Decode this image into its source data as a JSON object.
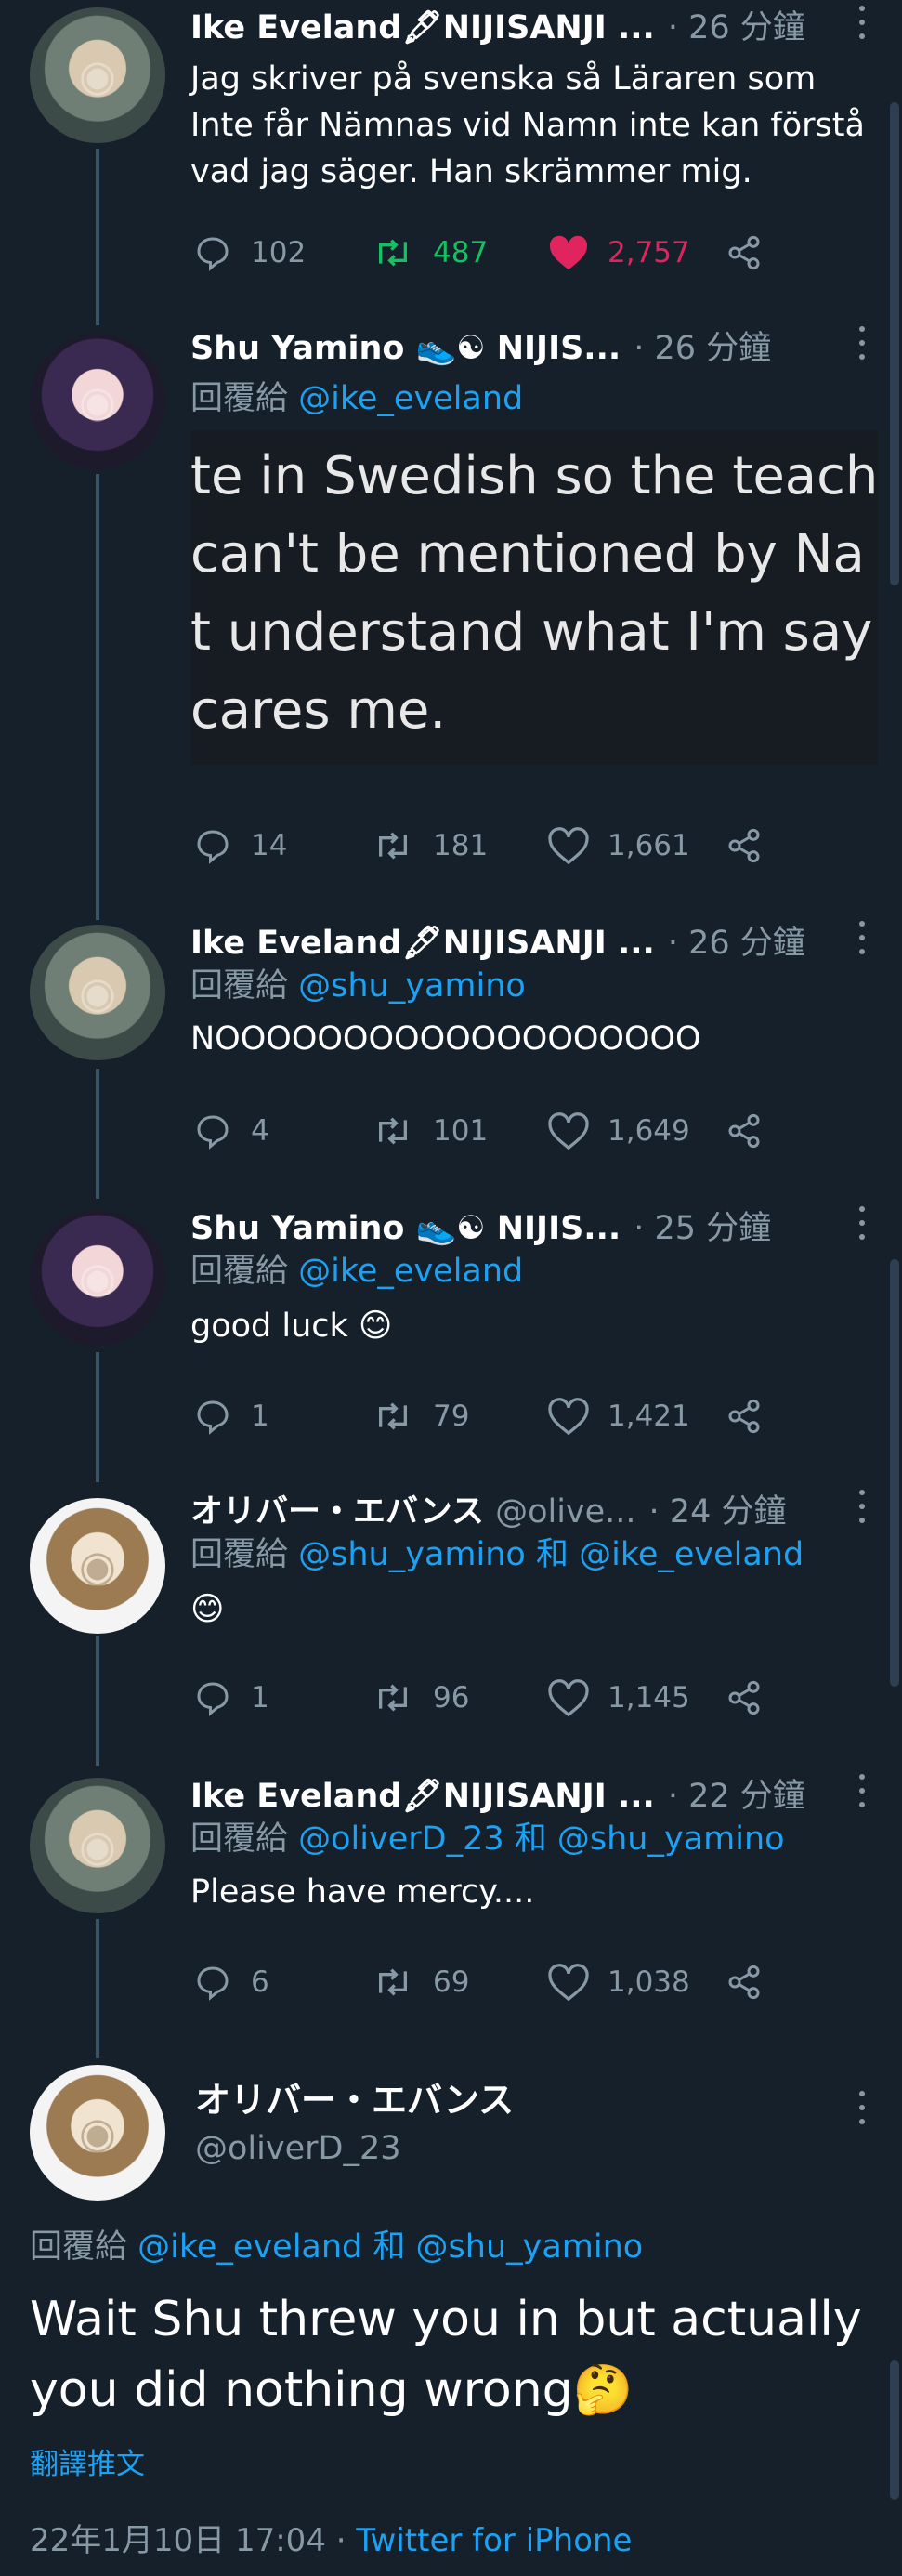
{
  "colors": {
    "background": "#15202b",
    "muted": "#8899a6",
    "link": "#1da1f2",
    "retweet_active": "#17bf63",
    "like_active": "#e0245e"
  },
  "tweets": [
    {
      "author": "Ike Eveland🖋NIJISANJI ...",
      "time": "· 26 分鐘",
      "text": "Jag skriver på svenska så Läraren som Inte får Nämnas vid Namn inte kan förstå vad jag säger. Han skrämmer mig.",
      "replies": "102",
      "retweets": "487",
      "likes": "2,757"
    },
    {
      "author": "Shu Yamino 👟☯ NIJIS...",
      "time": "· 26 分鐘",
      "reply_prefix": "回覆給 ",
      "reply_to": "@ike_eveland",
      "image_lines": [
        "te in Swedish so the teach",
        " can't be mentioned by Na",
        "t understand what I'm say",
        "cares me."
      ],
      "replies": "14",
      "retweets": "181",
      "likes": "1,661"
    },
    {
      "author": "Ike Eveland🖋NIJISANJI ...",
      "time": "· 26 分鐘",
      "reply_prefix": "回覆給 ",
      "reply_to": "@shu_yamino",
      "text": "NOOOOOOOOOOOOOOOOOOO",
      "replies": "4",
      "retweets": "101",
      "likes": "1,649"
    },
    {
      "author": "Shu Yamino 👟☯ NIJIS...",
      "time": "· 25 分鐘",
      "reply_prefix": "回覆給 ",
      "reply_to": "@ike_eveland",
      "text": "good luck 😊",
      "replies": "1",
      "retweets": "79",
      "likes": "1,421"
    },
    {
      "author": "オリバー・エバンス",
      "handle": "@olive...",
      "time": "· 24 分鐘",
      "reply_prefix": "回覆給 ",
      "reply_to": "@shu_yamino",
      "reply_and": " 和 ",
      "reply_to2": "@ike_eveland",
      "text": "😊",
      "replies": "1",
      "retweets": "96",
      "likes": "1,145"
    },
    {
      "author": "Ike Eveland🖋NIJISANJI ...",
      "time": "· 22 分鐘",
      "reply_prefix": "回覆給 ",
      "reply_to": "@oliverD_23",
      "reply_and": " 和 ",
      "reply_to2": "@shu_yamino",
      "text": "Please have mercy....",
      "replies": "6",
      "retweets": "69",
      "likes": "1,038"
    }
  ],
  "main_tweet": {
    "author": "オリバー・エバンス",
    "handle": "@oliverD_23",
    "reply_prefix": "回覆給 ",
    "reply_to": "@ike_eveland",
    "reply_and": " 和 ",
    "reply_to2": "@shu_yamino",
    "text": "Wait Shu threw you in but actually you did nothing wrong🤔",
    "translate": "翻譯推文",
    "date": "22年1月10日 17:04",
    "sep": " · ",
    "source": "Twitter for iPhone"
  }
}
